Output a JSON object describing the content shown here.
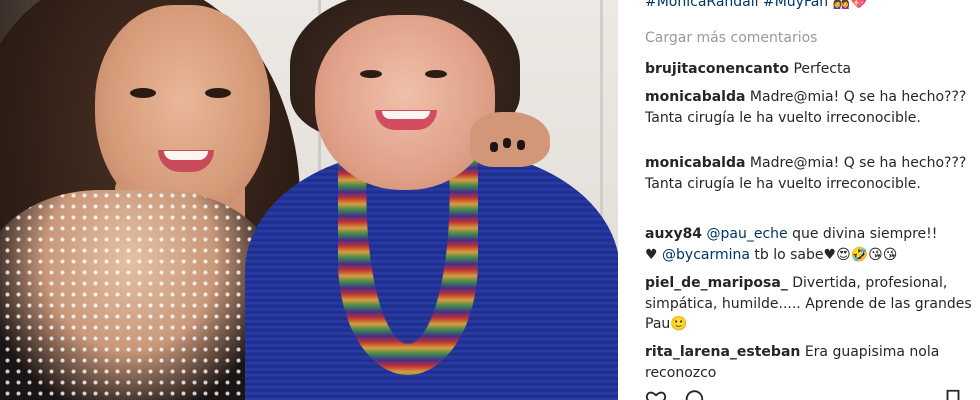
{
  "caption": {
    "hashtags": "#MonicaRandall #MuyFan",
    "emoji": "👩‍❤️‍👩💖"
  },
  "load_more_label": "Cargar más comentarios",
  "comments": [
    {
      "user": "brujitaconencanto",
      "text": "Perfecta"
    },
    {
      "user": "monicabalda",
      "text": "Madre@mia! Q se ha hecho??? Tanta cirugía le ha vuelto irreconocible."
    },
    {
      "user": "monicabalda",
      "text": "Madre@mia! Q se ha hecho??? Tanta cirugía le ha vuelto irreconocible."
    },
    {
      "user": "auxy84",
      "mention1": "@pau_eche",
      "text1": " que divina siempre!! ",
      "heart": "♥",
      "mention2": "@bycarmina",
      "text2": " tb lo sabe",
      "emojis": "♥😍🤣😘😘"
    },
    {
      "user": "piel_de_mariposa_",
      "text": "Divertida, profesional, simpática, humilde..... Aprende de las grandes Pau",
      "emoji": "🙂"
    },
    {
      "user": "rita_larena_esteban",
      "text": "Era guapisima nola reconozco"
    }
  ],
  "icons": [
    "heart-icon",
    "comment-icon",
    "bookmark-icon"
  ],
  "colors": {
    "link": "#003569",
    "muted": "#999999",
    "text": "#262626",
    "blouse": "#2a3ca8"
  }
}
